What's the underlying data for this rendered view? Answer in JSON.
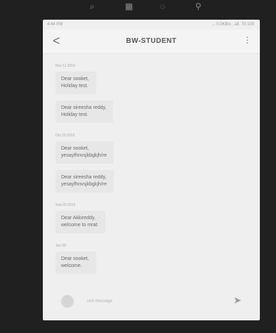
{
  "top_icons": [
    "search-icon",
    "grid-icon",
    "circle-icon",
    "bulb-icon"
  ],
  "statusbar": {
    "left": "4:44 PM",
    "right": "... 0.0KB/s ..all. 70 100"
  },
  "appbar": {
    "back_label": "<",
    "title": "BW-STUDENT",
    "menu_label": "⋮"
  },
  "groups": [
    {
      "date": "Nov 11 2019",
      "messages": [
        [
          "Dear sooket,",
          "Holiday test."
        ],
        [
          "Dear sireesha reddy,",
          "Holiday test."
        ]
      ]
    },
    {
      "date": "Oct 29 2019",
      "messages": [
        [
          "Dear sooket,",
          "yesayfhnvsjkbgkjh/re"
        ],
        [
          "Dear sireesha reddy,",
          "yesayfhnvsjkbgkjh/re"
        ]
      ]
    },
    {
      "date": "Sep 20 2019",
      "messages": [
        [
          "Dear Akkireddy,",
          "welcome to mrat."
        ]
      ]
    },
    {
      "date": "Jun 08",
      "messages": [
        [
          "Dear sooket,",
          "welcome."
        ]
      ]
    }
  ],
  "input": {
    "placeholder": "Text message"
  },
  "icons": {
    "emoji": "emoji-icon",
    "send": "send-icon"
  }
}
